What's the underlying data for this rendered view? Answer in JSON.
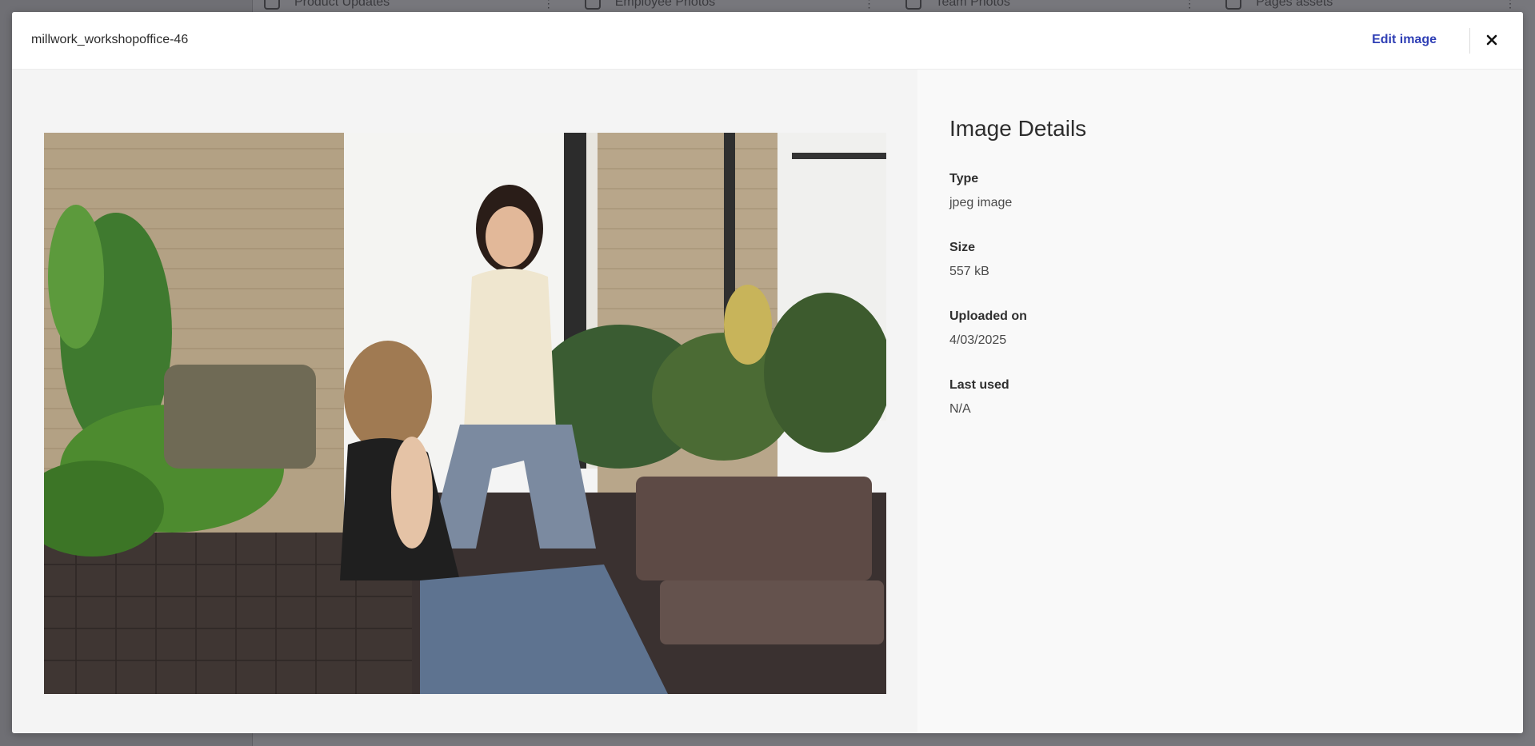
{
  "background": {
    "columns": [
      {
        "label": "Product Updates"
      },
      {
        "label": "Employee Photos"
      },
      {
        "label": "Team Photos"
      },
      {
        "label": "Pages assets"
      }
    ]
  },
  "modal": {
    "title": "millwork_workshopoffice-46",
    "edit_label": "Edit image",
    "close_icon": "close-icon",
    "accent_color": "#2f3fb5"
  },
  "details": {
    "heading": "Image Details",
    "type": {
      "label": "Type",
      "value": "jpeg image"
    },
    "size": {
      "label": "Size",
      "value": "557 kB"
    },
    "uploaded": {
      "label": "Uploaded on",
      "value": "4/03/2025"
    },
    "last_used": {
      "label": "Last used",
      "value": "N/A"
    }
  }
}
